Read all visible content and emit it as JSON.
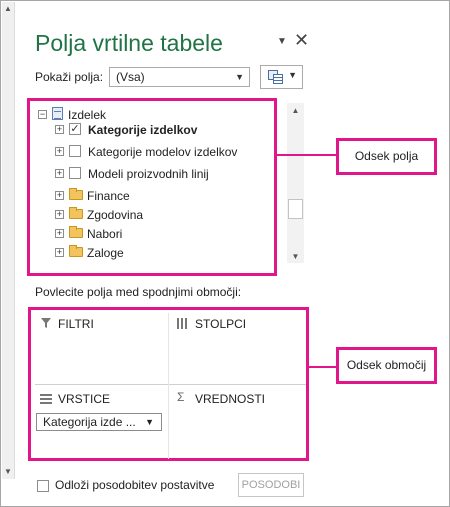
{
  "panel": {
    "title": "Polja vrtilne tabele",
    "title_controls": {
      "dropdown_icon": "chevron-down-icon",
      "close_icon": "close-icon",
      "close_glyph": "✕",
      "drop_glyph": "▼"
    }
  },
  "show_fields": {
    "label": "Pokaži polja:",
    "selected": "(Vsa)"
  },
  "field_tree": {
    "root": {
      "label": "Izdelek",
      "expander": "−"
    },
    "items": [
      {
        "label": "Kategorije izdelkov",
        "checked": true,
        "type": "field",
        "check_glyph": "✓"
      },
      {
        "label": "Kategorije modelov izdelkov",
        "checked": false,
        "type": "field"
      },
      {
        "label": "Modeli proizvodnih linij",
        "checked": false,
        "type": "field"
      },
      {
        "label": "Finance",
        "type": "folder"
      },
      {
        "label": "Zgodovina",
        "type": "folder"
      },
      {
        "label": "Nabori",
        "type": "folder"
      },
      {
        "label": "Zaloge",
        "type": "folder"
      }
    ],
    "expander_glyph": "+"
  },
  "callouts": {
    "field_section": "Odsek polja",
    "areas_section": "Odsek območij"
  },
  "drag_hint": "Povlecite polja med spodnjimi območji:",
  "areas": {
    "filters": {
      "label": "FILTRI",
      "icon": "filter-icon"
    },
    "columns": {
      "label": "STOLPCI",
      "icon": "columns-icon"
    },
    "rows": {
      "label": "VRSTICE",
      "icon": "rows-icon",
      "chip": "Kategorija izde ..."
    },
    "values": {
      "label": "VREDNOSTI",
      "icon": "sigma-icon",
      "glyph": "Σ"
    }
  },
  "footer": {
    "defer_label": "Odloži posodobitev postavitve",
    "update_button": "POSODOBI"
  },
  "colors": {
    "title_green": "#217346",
    "callout_magenta": "#e0168a"
  }
}
